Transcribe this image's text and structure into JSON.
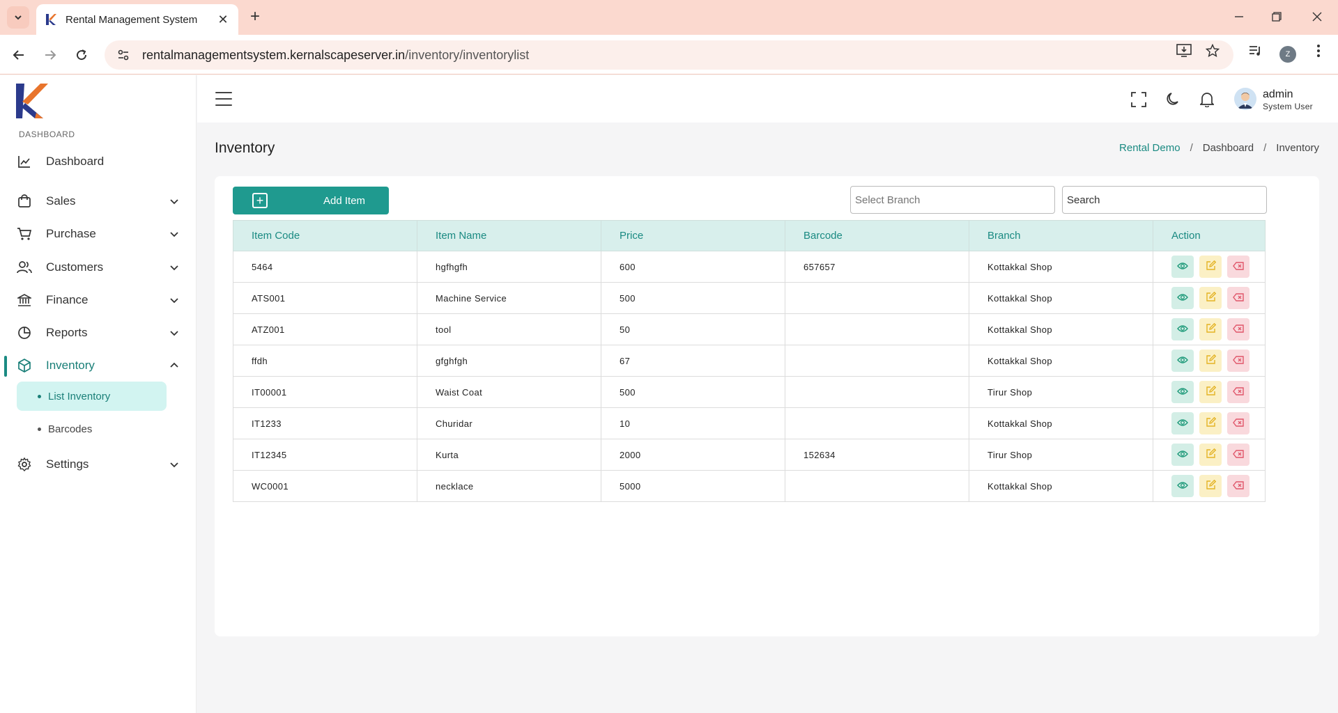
{
  "browser": {
    "tab_title": "Rental Management System",
    "url_host": "rentalmanagementsystem.kernalscapeserver.in",
    "url_path": "/inventory/inventorylist",
    "profile_initial": "Z"
  },
  "sidebar": {
    "section_label": "DASHBOARD",
    "items": [
      {
        "label": "Dashboard",
        "icon": "chart-icon"
      },
      {
        "label": "Sales",
        "icon": "shopping-bag-icon"
      },
      {
        "label": "Purchase",
        "icon": "cart-icon"
      },
      {
        "label": "Customers",
        "icon": "users-icon"
      },
      {
        "label": "Finance",
        "icon": "bank-icon"
      },
      {
        "label": "Reports",
        "icon": "pie-chart-icon"
      },
      {
        "label": "Inventory",
        "icon": "box-icon"
      },
      {
        "label": "Settings",
        "icon": "gear-icon"
      }
    ],
    "inventory_sub": [
      {
        "label": "List Inventory"
      },
      {
        "label": "Barcodes"
      }
    ]
  },
  "header": {
    "user_name": "admin",
    "user_role": "System User"
  },
  "page": {
    "title": "Inventory",
    "breadcrumb": [
      "Rental Demo",
      "Dashboard",
      "Inventory"
    ]
  },
  "toolbar": {
    "add_label": "Add Item",
    "branch_placeholder": "Select Branch",
    "search_placeholder": "Search"
  },
  "table": {
    "columns": [
      "Item Code",
      "Item Name",
      "Price",
      "Barcode",
      "Branch",
      "Action"
    ],
    "rows": [
      {
        "code": "5464",
        "name": "hgfhgfh",
        "price": "600",
        "barcode": "657657",
        "branch": "Kottakkal Shop"
      },
      {
        "code": "ATS001",
        "name": "Machine Service",
        "price": "500",
        "barcode": "",
        "branch": "Kottakkal Shop"
      },
      {
        "code": "ATZ001",
        "name": "tool",
        "price": "50",
        "barcode": "",
        "branch": "Kottakkal Shop"
      },
      {
        "code": "ffdh",
        "name": "gfghfgh",
        "price": "67",
        "barcode": "",
        "branch": "Kottakkal Shop"
      },
      {
        "code": "IT00001",
        "name": "Waist Coat",
        "price": "500",
        "barcode": "",
        "branch": "Tirur Shop"
      },
      {
        "code": "IT1233",
        "name": "Churidar",
        "price": "10",
        "barcode": "",
        "branch": "Kottakkal Shop"
      },
      {
        "code": "IT12345",
        "name": "Kurta",
        "price": "2000",
        "barcode": "152634",
        "branch": "Tirur Shop"
      },
      {
        "code": "WC0001",
        "name": "necklace",
        "price": "5000",
        "barcode": "",
        "branch": "Kottakkal Shop"
      }
    ]
  },
  "colors": {
    "accent": "#1f9a8f",
    "tab_strip": "#fbd9cf",
    "view_bg": "#d3eee6",
    "edit_bg": "#fbf0c5",
    "delete_bg": "#f9d9dd"
  }
}
